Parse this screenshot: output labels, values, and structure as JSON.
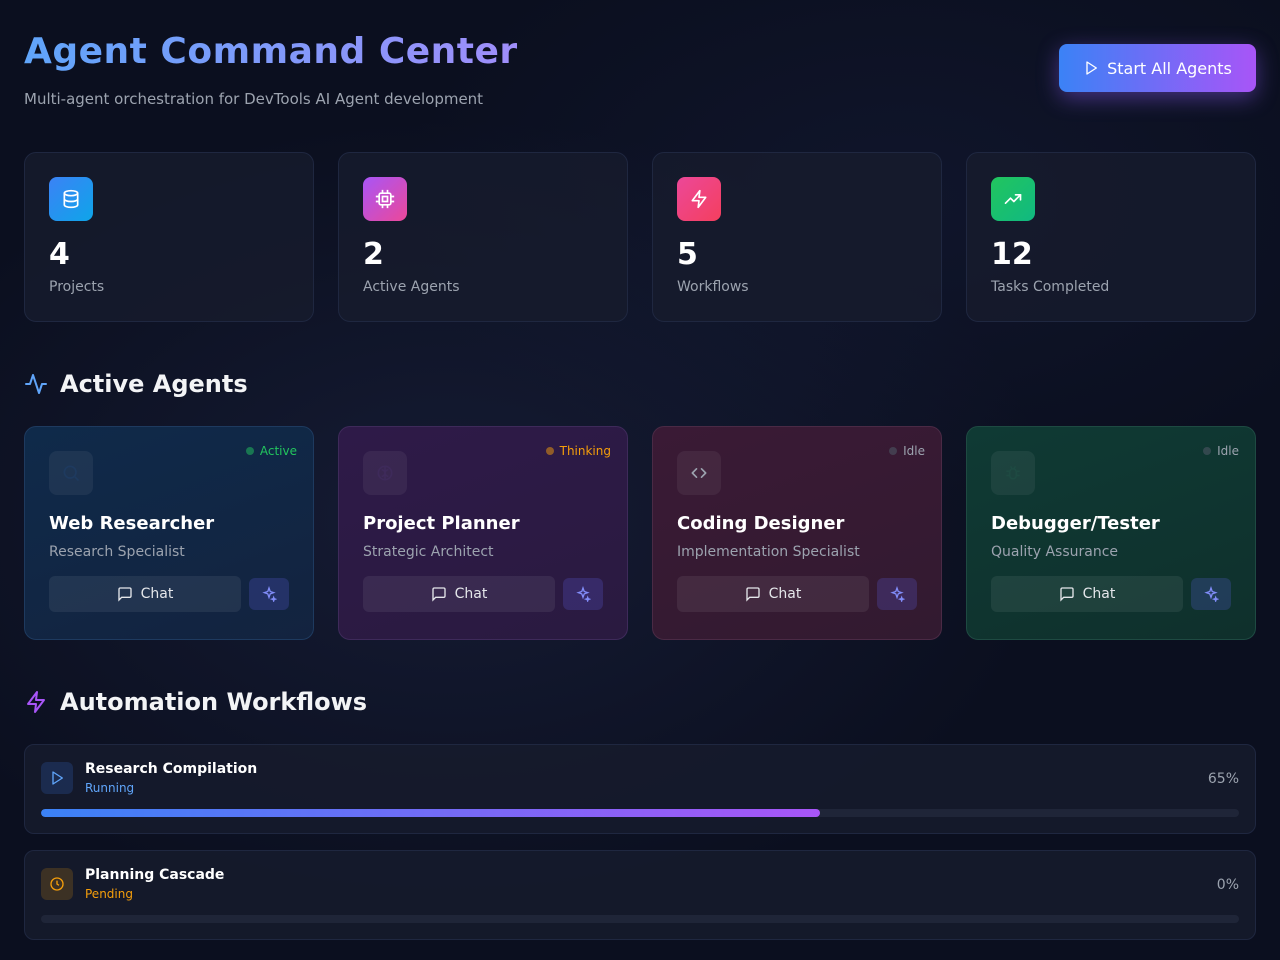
{
  "header": {
    "title": "Agent Command Center",
    "subtitle": "Multi-agent orchestration for DevTools AI Agent development",
    "start_button": "Start All Agents"
  },
  "stats": [
    {
      "icon": "database-icon",
      "value": "4",
      "label": "Projects",
      "color_from": "#3b82f6",
      "color_to": "#0ea5e9"
    },
    {
      "icon": "cpu-icon",
      "value": "2",
      "label": "Active Agents",
      "color_from": "#a855f7",
      "color_to": "#ec4899"
    },
    {
      "icon": "lightning-icon",
      "value": "5",
      "label": "Workflows",
      "color_from": "#ec4899",
      "color_to": "#f43f5e"
    },
    {
      "icon": "trending-up-icon",
      "value": "12",
      "label": "Tasks Completed",
      "color_from": "#22c55e",
      "color_to": "#10b981"
    }
  ],
  "agents_section": {
    "title": "Active Agents",
    "icon": "activity-icon"
  },
  "agents": [
    {
      "icon": "search-icon",
      "name": "Web Researcher",
      "role": "Research Specialist",
      "status": "Active",
      "status_color": "#22c55e",
      "bg": "linear-gradient(160deg,#0f2a4a,#13233f)",
      "border": "#1e3a5f",
      "chat": "Chat"
    },
    {
      "icon": "brain-icon",
      "name": "Project Planner",
      "role": "Strategic Architect",
      "status": "Thinking",
      "status_color": "#f59e0b",
      "bg": "linear-gradient(160deg,#2e1a48,#2a1a40)",
      "border": "#3e2a5a",
      "chat": "Chat"
    },
    {
      "icon": "code-icon",
      "name": "Coding Designer",
      "role": "Implementation Specialist",
      "status": "Idle",
      "status_color": "#6b7280",
      "bg": "linear-gradient(160deg,#3a1a35,#321a30)",
      "border": "#4a2a45",
      "chat": "Chat"
    },
    {
      "icon": "bug-icon",
      "name": "Debugger/Tester",
      "role": "Quality Assurance",
      "status": "Idle",
      "status_color": "#6b7280",
      "bg": "linear-gradient(160deg,#0f3a34,#0f302c)",
      "border": "#1e4a42",
      "chat": "Chat"
    }
  ],
  "workflows_section": {
    "title": "Automation Workflows",
    "icon": "lightning-icon"
  },
  "workflows": [
    {
      "icon": "play-icon",
      "name": "Research Compilation",
      "status": "Running",
      "status_color": "#60a5fa",
      "icon_bg": "rgba(59,130,246,0.18)",
      "percent_label": "65%",
      "progress": 0.65
    },
    {
      "icon": "clock-icon",
      "name": "Planning Cascade",
      "status": "Pending",
      "status_color": "#f59e0b",
      "icon_bg": "rgba(245,158,11,0.18)",
      "percent_label": "0%",
      "progress": 0
    }
  ]
}
